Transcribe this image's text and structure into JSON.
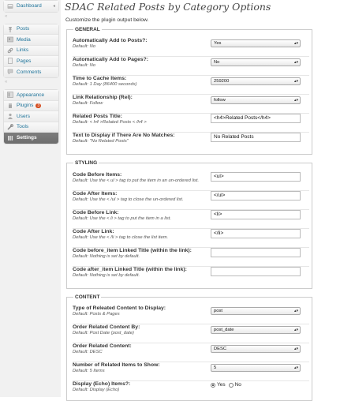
{
  "sidebar": {
    "items": [
      {
        "label": "Dashboard",
        "icon": "dashboard-icon"
      },
      {
        "label": "Posts",
        "icon": "pin-icon"
      },
      {
        "label": "Media",
        "icon": "media-icon"
      },
      {
        "label": "Links",
        "icon": "link-icon"
      },
      {
        "label": "Pages",
        "icon": "page-icon"
      },
      {
        "label": "Comments",
        "icon": "comment-icon"
      },
      {
        "label": "Appearance",
        "icon": "appearance-icon"
      },
      {
        "label": "Plugins",
        "icon": "plugin-icon",
        "badge": "3"
      },
      {
        "label": "Users",
        "icon": "users-icon"
      },
      {
        "label": "Tools",
        "icon": "tools-icon"
      },
      {
        "label": "Settings",
        "icon": "settings-icon"
      }
    ]
  },
  "page": {
    "title": "SDAC Related Posts by Category Options",
    "description": "Customize the plugin output below."
  },
  "general": {
    "legend": "GENERAL",
    "auto_posts": {
      "label": "Automatically Add to Posts?:",
      "default": "Default: No",
      "value": "Yes"
    },
    "auto_pages": {
      "label": "Automatically Add to Pages?:",
      "default": "Default: No",
      "value": "No"
    },
    "cache_time": {
      "label": "Time to Cache Items:",
      "default": "Default: 1 Day (86400 seconds)",
      "value": "259200"
    },
    "link_rel": {
      "label": "Link Relationship (Rel):",
      "default": "Default: Follow",
      "value": "follow"
    },
    "posts_title": {
      "label": "Related Posts Title:",
      "default": "Default: < h4 >Related Posts < /h4 >",
      "value": "<h4>Related Posts</h4>"
    },
    "no_match": {
      "label": "Text to Display if There Are No Matches:",
      "default": "Default: \"No Related Posts\"",
      "value": "No Related Posts"
    }
  },
  "styling": {
    "legend": "STYLING",
    "before_items": {
      "label": "Code Before Items:",
      "default": "Default: Use the < ul > tag to put the item in an un-ordered list.",
      "value": "<ul>"
    },
    "after_items": {
      "label": "Code After Items:",
      "default": "Default: Use the < /ul > tag to close the un-ordered list.",
      "value": "</ul>"
    },
    "before_link": {
      "label": "Code Before Link:",
      "default": "Default: Use the < li > tag to put the item in a list.",
      "value": "<li>"
    },
    "after_link": {
      "label": "Code After Link:",
      "default": "Default: Use the < /li > tag to close the list item.",
      "value": "</li>"
    },
    "before_title": {
      "label": "Code before_item Linked Title (within the link):",
      "default": "Default: Nothing is set by default.",
      "value": ""
    },
    "after_title": {
      "label": "Code after_item Linked Title (within the link):",
      "default": "Default: Nothing is set by default.",
      "value": ""
    }
  },
  "content": {
    "legend": "CONTENT",
    "type": {
      "label": "Type of Releated Content to Display:",
      "default": "Default: Posts & Pages",
      "value": "post"
    },
    "order_by": {
      "label": "Order Related Content By:",
      "default": "Default: Post Date (post_date)",
      "value": "post_date"
    },
    "order": {
      "label": "Order Related Content:",
      "default": "Default: DESC",
      "value": "DESC"
    },
    "count": {
      "label": "Number of Related Items to Show:",
      "default": "Default: 5 Items",
      "value": "5"
    },
    "display": {
      "label": "Display (Echo) Items?:",
      "default": "Default: Display (Echo)",
      "yes": "Yes",
      "no": "No"
    }
  }
}
